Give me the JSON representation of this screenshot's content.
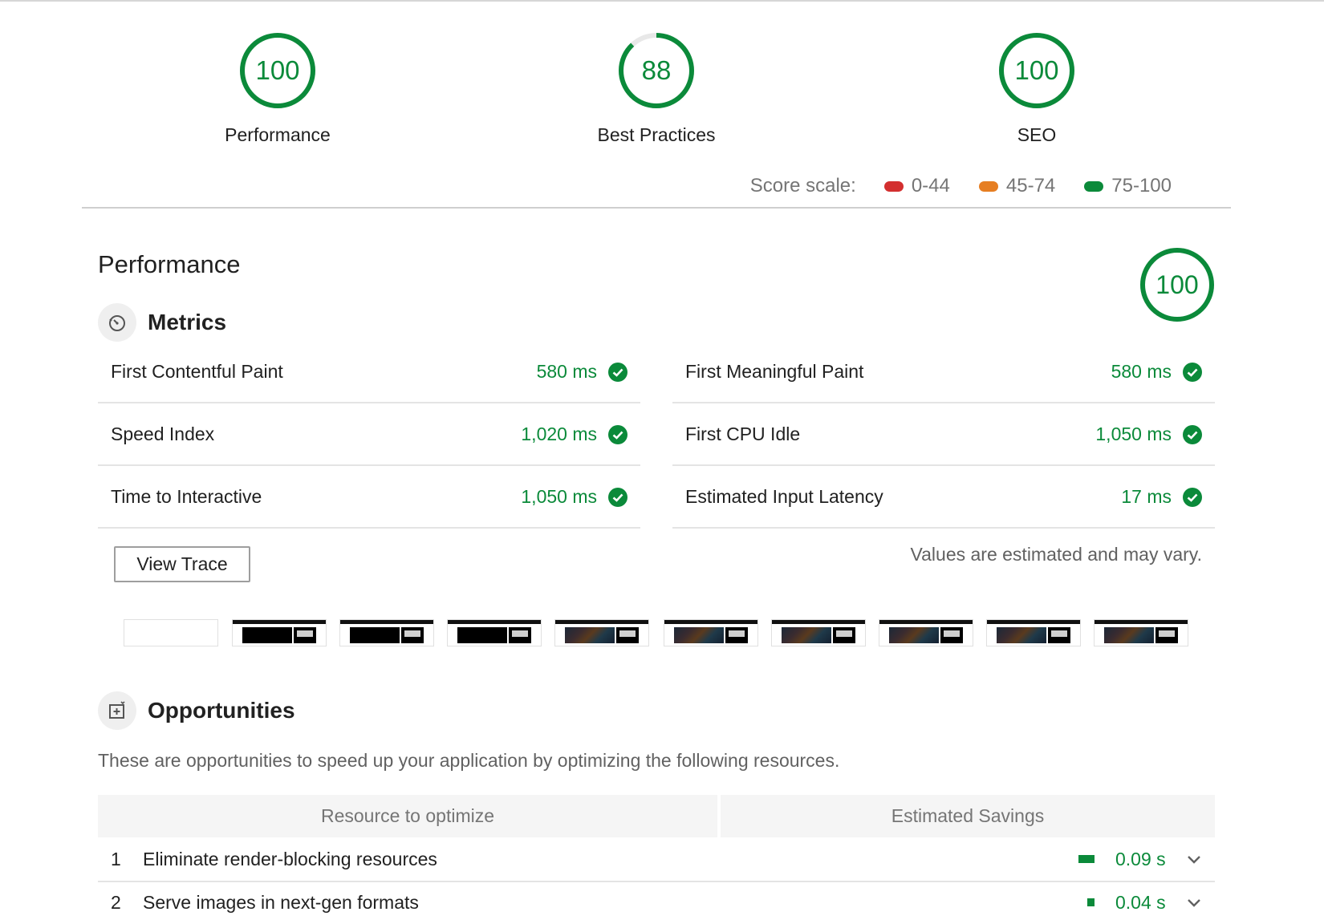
{
  "gauges": [
    {
      "score": "100",
      "label": "Performance",
      "fraction": 1.0
    },
    {
      "score": "88",
      "label": "Best Practices",
      "fraction": 0.88
    },
    {
      "score": "100",
      "label": "SEO",
      "fraction": 1.0
    }
  ],
  "score_scale": {
    "label": "Score scale:",
    "ranges": [
      {
        "text": "0-44",
        "color": "#d32f2f"
      },
      {
        "text": "45-74",
        "color": "#e67e22"
      },
      {
        "text": "75-100",
        "color": "#0b8a3a"
      }
    ]
  },
  "performance": {
    "title": "Performance",
    "score": "100",
    "metrics_title": "Metrics",
    "metrics": [
      {
        "name": "First Contentful Paint",
        "value": "580 ms"
      },
      {
        "name": "First Meaningful Paint",
        "value": "580 ms"
      },
      {
        "name": "Speed Index",
        "value": "1,020 ms"
      },
      {
        "name": "First CPU Idle",
        "value": "1,050 ms"
      },
      {
        "name": "Time to Interactive",
        "value": "1,050 ms"
      },
      {
        "name": "Estimated Input Latency",
        "value": "17 ms"
      }
    ],
    "view_trace": "View Trace",
    "note": "Values are estimated and may vary."
  },
  "opportunities": {
    "title": "Opportunities",
    "description": "These are opportunities to speed up your application by optimizing the following resources.",
    "col_resource": "Resource to optimize",
    "col_savings": "Estimated Savings",
    "rows": [
      {
        "index": "1",
        "title": "Eliminate render-blocking resources",
        "savings": "0.09 s",
        "fraction": 0.09
      },
      {
        "index": "2",
        "title": "Serve images in next-gen formats",
        "savings": "0.04 s",
        "fraction": 0.04
      }
    ]
  },
  "colors": {
    "pass": "#0b8a3a",
    "track": "#e8e8e8"
  }
}
